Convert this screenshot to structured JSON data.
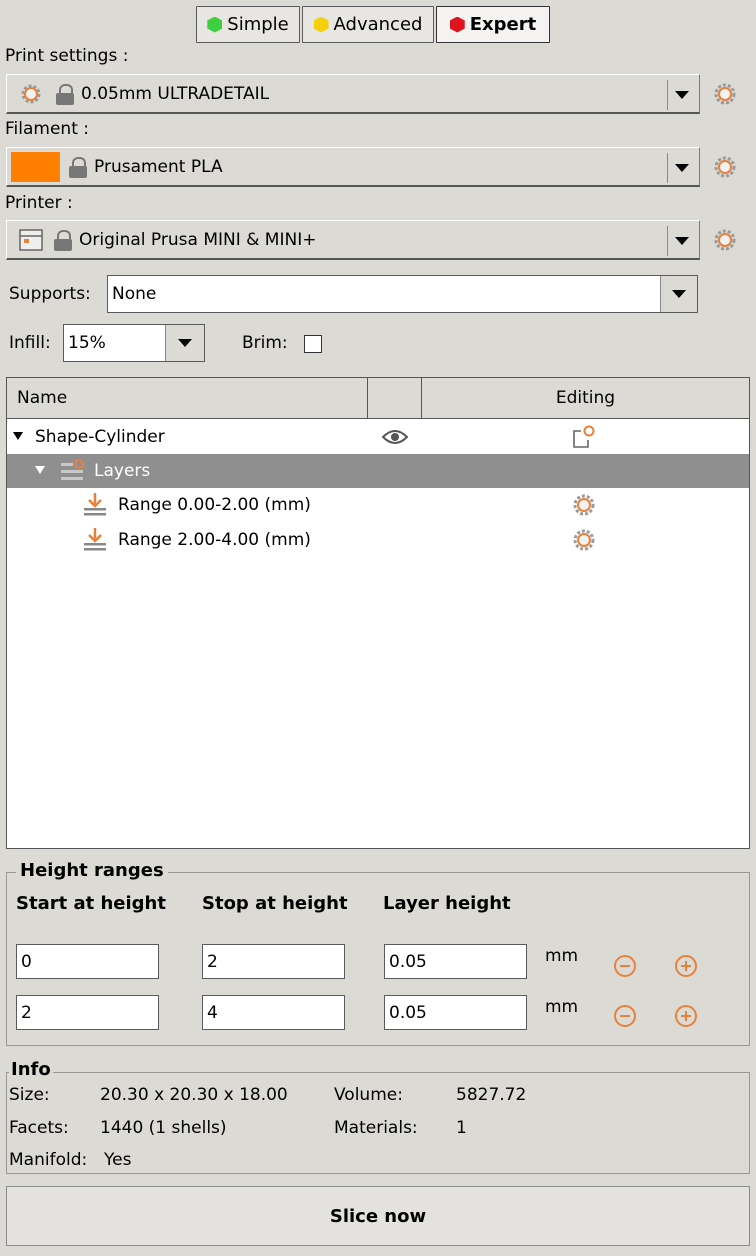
{
  "modes": {
    "simple": "Simple",
    "advanced": "Advanced",
    "expert": "Expert"
  },
  "print_settings": {
    "label": "Print settings :",
    "value": "0.05mm ULTRADETAIL"
  },
  "filament": {
    "label": "Filament :",
    "value": "Prusament PLA",
    "color": "#ff7f00"
  },
  "printer": {
    "label": "Printer :",
    "value": "Original Prusa MINI & MINI+"
  },
  "supports": {
    "label": "Supports:",
    "value": "None"
  },
  "infill": {
    "label": "Infill:",
    "value": "15%"
  },
  "brim": {
    "label": "Brim:",
    "checked": false
  },
  "tree": {
    "columns": {
      "name": "Name",
      "editing": "Editing"
    },
    "object": "Shape-Cylinder",
    "layers": "Layers",
    "ranges": [
      "Range 0.00-2.00 (mm)",
      "Range 2.00-4.00 (mm)"
    ]
  },
  "height_ranges": {
    "title": "Height ranges",
    "headers": {
      "start": "Start at height",
      "stop": "Stop at height",
      "layer": "Layer height"
    },
    "unit": "mm",
    "rows": [
      {
        "start": "0",
        "stop": "2",
        "layer": "0.05"
      },
      {
        "start": "2",
        "stop": "4",
        "layer": "0.05"
      }
    ]
  },
  "info": {
    "title": "Info",
    "size_label": "Size:",
    "size_value": "20.30 x 20.30 x 18.00",
    "volume_label": "Volume:",
    "volume_value": "5827.72",
    "facets_label": "Facets:",
    "facets_value": "1440 (1 shells)",
    "materials_label": "Materials:",
    "materials_value": "1",
    "manifold_label": "Manifold:",
    "manifold_value": "Yes"
  },
  "slice_button": "Slice now",
  "colors": {
    "accent": "#e8813b",
    "simple": "#3ecf3e",
    "advanced": "#f5d00a",
    "expert": "#e0141e",
    "selected_row": "#8f8f8f"
  }
}
